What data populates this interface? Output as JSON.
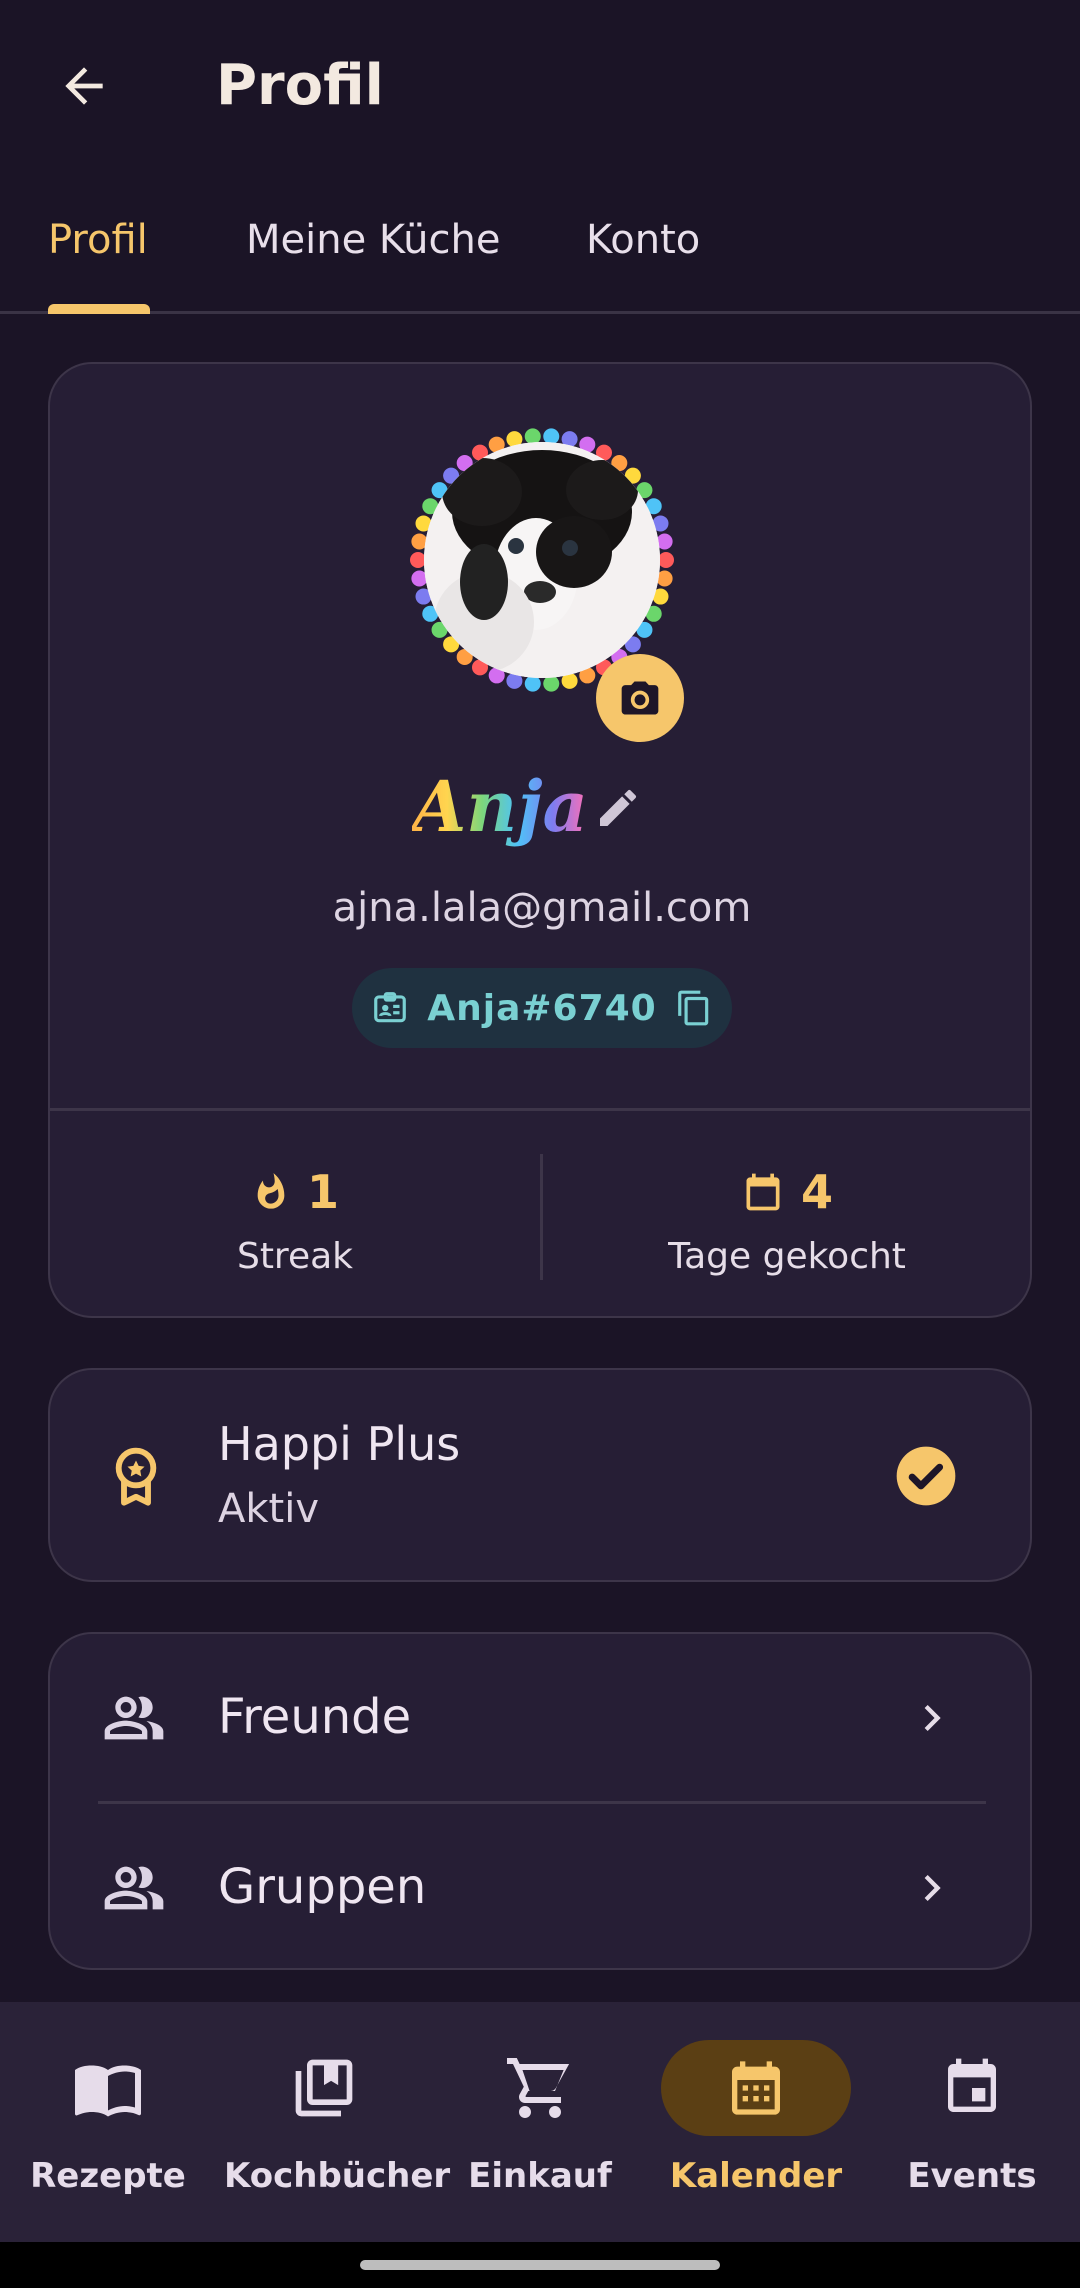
{
  "header": {
    "title": "Profil"
  },
  "tabs": [
    {
      "label": "Profil"
    },
    {
      "label": "Meine Küche"
    },
    {
      "label": "Konto"
    }
  ],
  "profile": {
    "display_name": "Anja",
    "email": "ajna.lala@gmail.com",
    "user_tag": "Anja#6740",
    "stats": [
      {
        "value": "1",
        "label": "Streak",
        "icon": "flame-icon"
      },
      {
        "value": "4",
        "label": "Tage gekocht",
        "icon": "calendar-icon"
      }
    ]
  },
  "subscription": {
    "title": "Happi Plus",
    "status": "Aktiv"
  },
  "social": [
    {
      "label": "Freunde",
      "icon": "people-icon"
    },
    {
      "label": "Gruppen",
      "icon": "people-icon"
    }
  ],
  "bottom_nav": [
    {
      "label": "Rezepte",
      "icon": "book-icon"
    },
    {
      "label": "Kochbücher",
      "icon": "bookmark-library-icon"
    },
    {
      "label": "Einkauf",
      "icon": "cart-icon"
    },
    {
      "label": "Kalender",
      "icon": "calendar-grid-icon",
      "active": true
    },
    {
      "label": "Events",
      "icon": "event-icon"
    }
  ],
  "colors": {
    "background": "#1b1426",
    "card": "#261e35",
    "accent": "#f6c66b",
    "tag_text": "#7ad0d2"
  }
}
